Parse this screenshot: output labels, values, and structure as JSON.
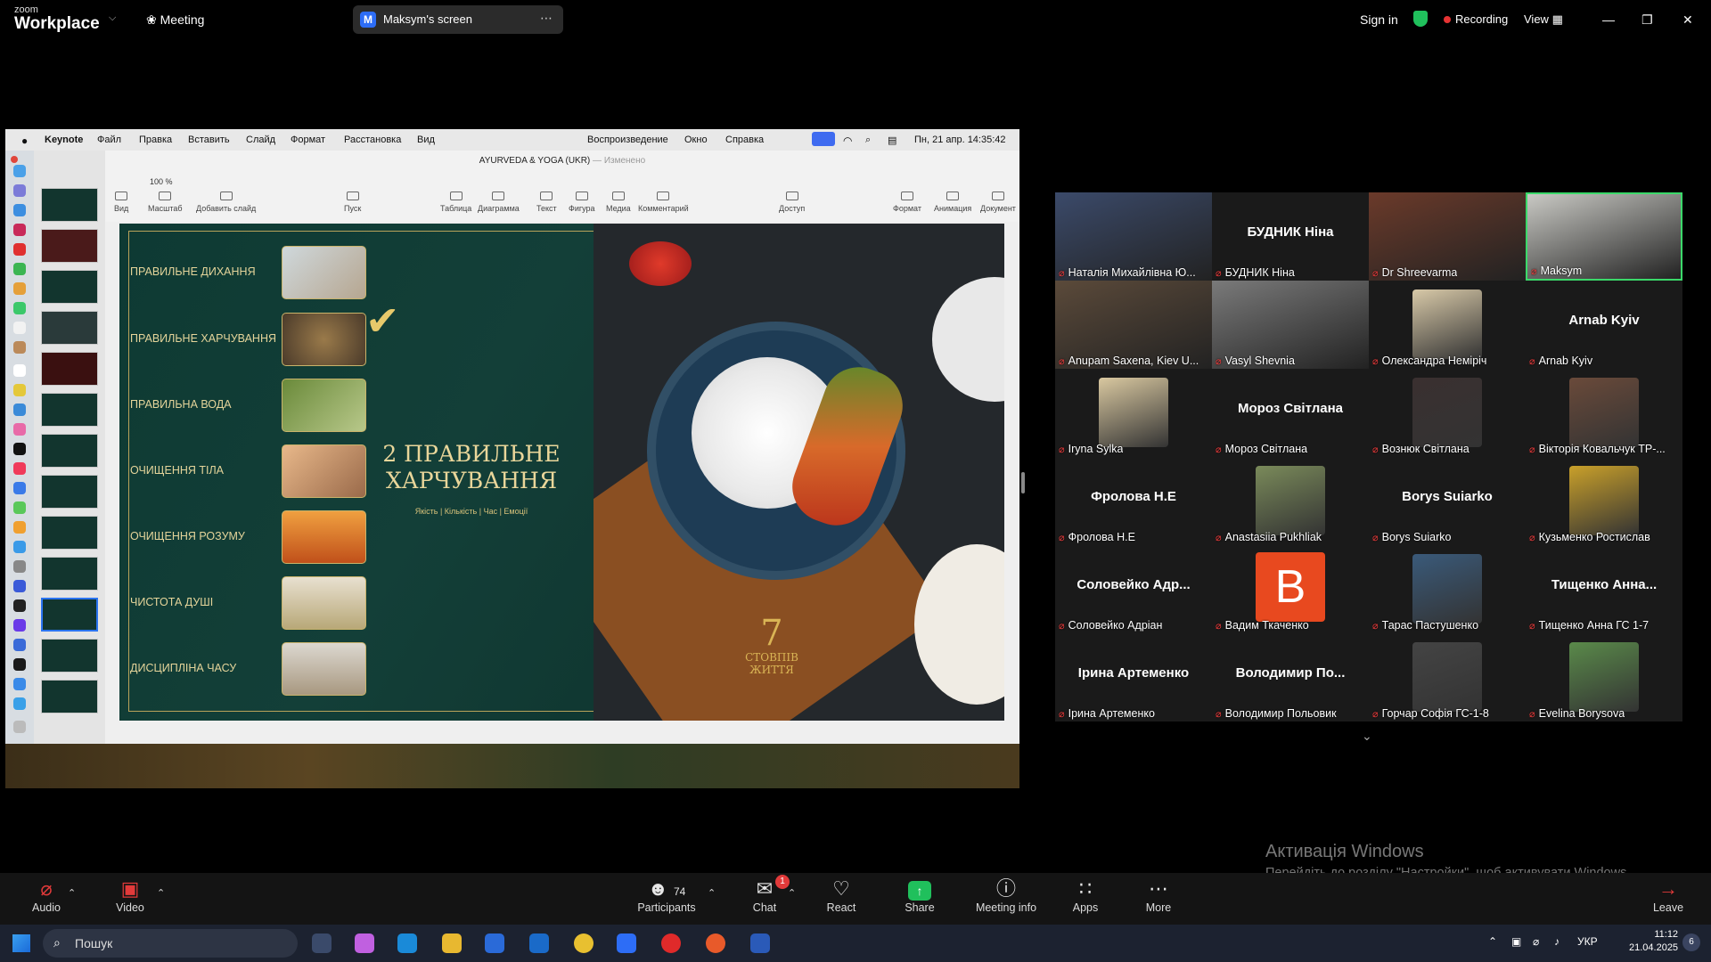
{
  "zoom": {
    "logo_top": "zoom",
    "logo_bottom": "Workplace",
    "meeting_label": "Meeting",
    "screen_badge": "M",
    "screen_label": "Maksym's screen",
    "sign_in": "Sign in",
    "recording": "Recording",
    "view": "View"
  },
  "mac_menu": {
    "app": "Keynote",
    "items": [
      "Файл",
      "Правка",
      "Вставить",
      "Слайд",
      "Формат",
      "Расстановка",
      "Вид"
    ],
    "right_items": [
      "Воспроизведение",
      "Окно",
      "Справка"
    ],
    "clock": "Пн, 21 апр.  14:35:42"
  },
  "keynote": {
    "doc_title": "AYURVEDA & YOGA (UKR)",
    "doc_modified": "— Изменено",
    "zoom_level": "100 %",
    "toolbar": [
      {
        "label": "Вид",
        "icon": "view-icon"
      },
      {
        "label": "Масштаб",
        "icon": "zoom-icon"
      },
      {
        "label": "Добавить слайд",
        "icon": "add-slide-icon"
      },
      {
        "label": "Пуск",
        "icon": "play-icon"
      },
      {
        "label": "Таблица",
        "icon": "table-icon"
      },
      {
        "label": "Диаграмма",
        "icon": "chart-icon"
      },
      {
        "label": "Текст",
        "icon": "text-icon"
      },
      {
        "label": "Фигура",
        "icon": "shape-icon"
      },
      {
        "label": "Медиа",
        "icon": "media-icon"
      },
      {
        "label": "Комментарий",
        "icon": "comment-icon"
      },
      {
        "label": "Доступ",
        "icon": "share-icon"
      },
      {
        "label": "Формат",
        "icon": "format-icon"
      },
      {
        "label": "Анимация",
        "icon": "animation-icon"
      },
      {
        "label": "Документ",
        "icon": "document-icon"
      }
    ]
  },
  "slide": {
    "rows": [
      "ПРАВИЛЬНЕ ДИХАННЯ",
      "ПРАВИЛЬНЕ ХАРЧУВАННЯ",
      "ПРАВИЛЬНА ВОДА",
      "ОЧИЩЕННЯ ТІЛА",
      "ОЧИЩЕННЯ РОЗУМУ",
      "ЧИСТОТА ДУШІ",
      "ДИСЦИПЛІНА ЧАСУ"
    ],
    "center_title": "2 ПРАВИЛЬНЕ ХАРЧУВАННЯ",
    "center_subtitle": "Якість | Кількість | Час | Емоції",
    "logo_number": "7",
    "logo_line1": "СТОВПІВ",
    "logo_line2": "ЖИТТЯ"
  },
  "participants": [
    {
      "name": "Наталія Михайлівна Ю...",
      "mode": "photo",
      "color": "#3b4a6a"
    },
    {
      "name": "БУДНИК Ніна",
      "mode": "text",
      "display": "БУДНИК Ніна"
    },
    {
      "name": "Dr Shreevarma",
      "mode": "photo",
      "color": "#6b3a2a"
    },
    {
      "name": "Maksym",
      "mode": "photo",
      "color": "#c9c9c4",
      "active": true
    },
    {
      "name": "Anupam Saxena, Kiev U...",
      "mode": "photo",
      "color": "#5b4a3a"
    },
    {
      "name": "Vasyl Shevnia",
      "mode": "photo",
      "color": "#7a7a7a"
    },
    {
      "name": "Олександра Неміріч",
      "mode": "avatar",
      "color": "#d8c9a8"
    },
    {
      "name": "Arnab Kyiv",
      "mode": "text",
      "display": "Arnab Kyiv"
    },
    {
      "name": "Iryna Sylka",
      "mode": "avatar",
      "color": "#d9c8a0"
    },
    {
      "name": "Мороз Світлана",
      "mode": "text",
      "display": "Мороз Світлана"
    },
    {
      "name": "Вознюк Світлана",
      "mode": "avatar",
      "color": "#3a3030"
    },
    {
      "name": "Вікторія Ковальчук ТР-...",
      "mode": "avatar",
      "color": "#6a4a3a"
    },
    {
      "name": "Фролова Н.Е",
      "mode": "text",
      "display": "Фролова Н.Е"
    },
    {
      "name": "Anastasiia Pukhliak",
      "mode": "avatar",
      "color": "#7a8a5a"
    },
    {
      "name": "Borys Suiarko",
      "mode": "text",
      "display": "Borys Suiarko"
    },
    {
      "name": "Кузьменко Ростислав",
      "mode": "avatar",
      "color": "#c9a02a"
    },
    {
      "name": "Соловейко Адріан",
      "mode": "text",
      "display": "Соловейко Адр..."
    },
    {
      "name": "Вадим Ткаченко",
      "mode": "letter",
      "display": "B"
    },
    {
      "name": "Тарас Пастушенко",
      "mode": "avatar",
      "color": "#3a5a7a"
    },
    {
      "name": "Тищенко Анна ГС 1-7",
      "mode": "text",
      "display": "Тищенко Анна..."
    },
    {
      "name": "Ірина Артеменко",
      "mode": "text",
      "display": "Ірина Артеменко"
    },
    {
      "name": "Володимир Польовик",
      "mode": "text",
      "display": "Володимир По..."
    },
    {
      "name": "Горчар Софія ГС-1-8",
      "mode": "avatar",
      "color": "#444"
    },
    {
      "name": "Evelina Borysova",
      "mode": "avatar",
      "color": "#5a8a4a"
    }
  ],
  "watermark": {
    "line1": "Активація Windows",
    "line2": "Перейдіть до розділу \"Настройки\", щоб активувати Windows."
  },
  "controls": {
    "audio": "Audio",
    "video": "Video",
    "participants": "Participants",
    "participants_count": "74",
    "chat": "Chat",
    "chat_badge": "1",
    "react": "React",
    "share": "Share",
    "meeting_info": "Meeting info",
    "apps": "Apps",
    "more": "More",
    "leave": "Leave"
  },
  "taskbar": {
    "search_placeholder": "Пошук",
    "language": "УКР",
    "time": "11:12",
    "date": "21.04.2025",
    "notif_count": "6"
  },
  "colors": {
    "active_speaker": "#3bd96a",
    "recording": "#e63333",
    "share_green": "#20c05c",
    "slide_gold": "#e4d49a"
  }
}
